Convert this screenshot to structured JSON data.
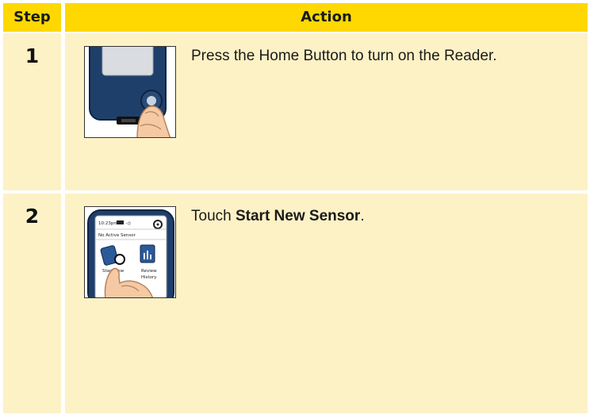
{
  "table": {
    "header": {
      "step": "Step",
      "action": "Action"
    },
    "rows": [
      {
        "step": "1",
        "action_text": "Press the Home Button to turn on the Reader.",
        "image_icon": "reader-home-button-press"
      },
      {
        "step": "2",
        "action_prefix": "Touch ",
        "action_bold": "Start New Sensor",
        "action_suffix": ".",
        "image_icon": "reader-start-new-sensor-touch",
        "screen": {
          "time": "10:23pm",
          "status": "No Active Sensor",
          "btn_start_line1": "Start New",
          "btn_review_line1": "Review",
          "btn_review_line2": "History"
        }
      }
    ]
  },
  "colors": {
    "header_bg": "#fed800",
    "cell_bg": "#fdf2c6",
    "device_blue": "#1f3f6b"
  }
}
